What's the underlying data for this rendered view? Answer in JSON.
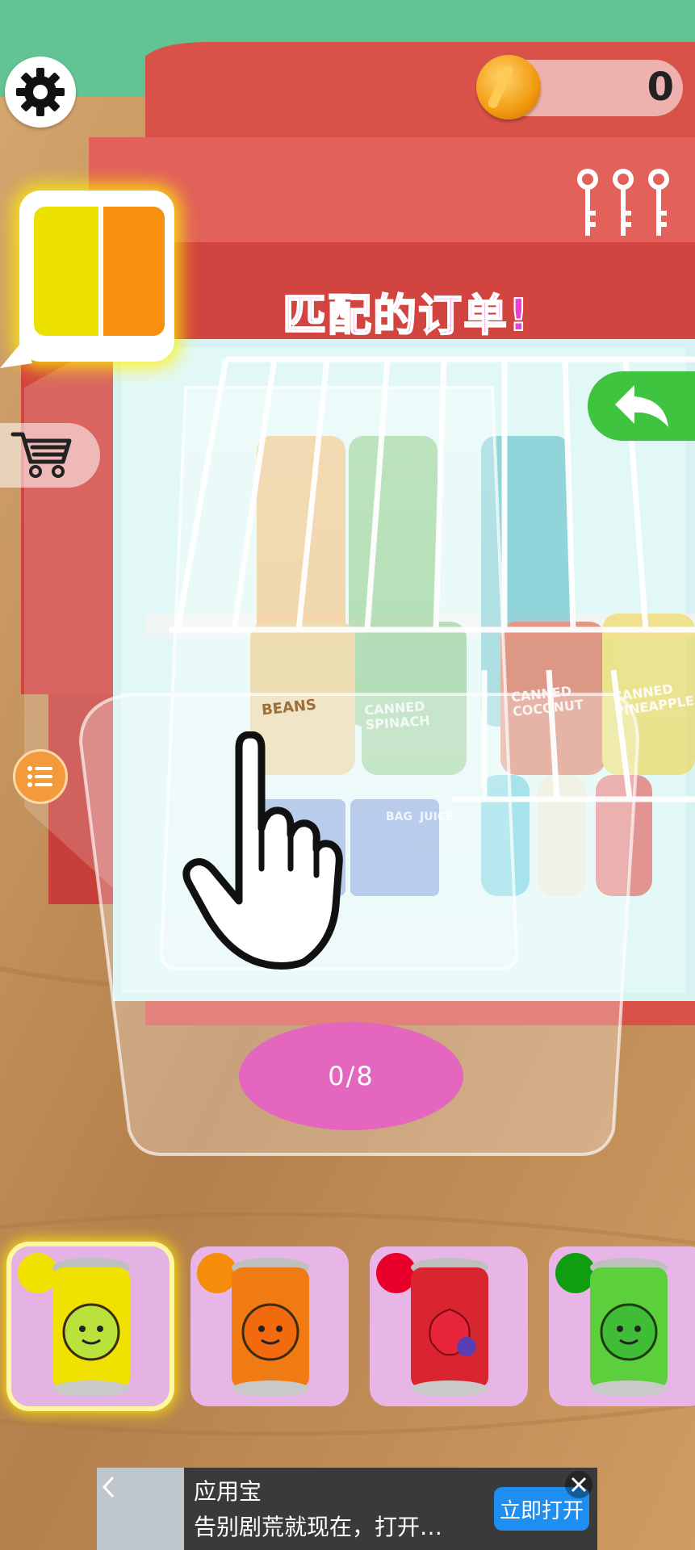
{
  "hud": {
    "coins": "0",
    "match_text": "匹配的订单!",
    "progress": "0/8"
  },
  "order": {
    "colors": [
      "#ece000",
      "#f7900c"
    ]
  },
  "shelf_labels": [
    "BEANS",
    "CANNED SPINACH",
    "CANNED COCONUT",
    "CANNED PINEAPPLE",
    "BAG",
    "JUICE"
  ],
  "tray": [
    {
      "name": "yellow-can",
      "dot": "#f2e200",
      "can": "#f1e100",
      "fruit": "#b9e33a",
      "selected": true
    },
    {
      "name": "orange-can",
      "dot": "#f58d0a",
      "can": "#f07b12",
      "fruit": "#f26a0e",
      "selected": false
    },
    {
      "name": "red-can",
      "dot": "#e8002a",
      "can": "#d9252f",
      "fruit": "#e8253a",
      "selected": false
    },
    {
      "name": "green-can",
      "dot": "#119d10",
      "can": "#5ccf3c",
      "fruit": "#3fbd37",
      "selected": false
    }
  ],
  "ad": {
    "title": "应用宝",
    "desc": "告别剧荒就现在，打开…",
    "cta": "立即打开"
  }
}
